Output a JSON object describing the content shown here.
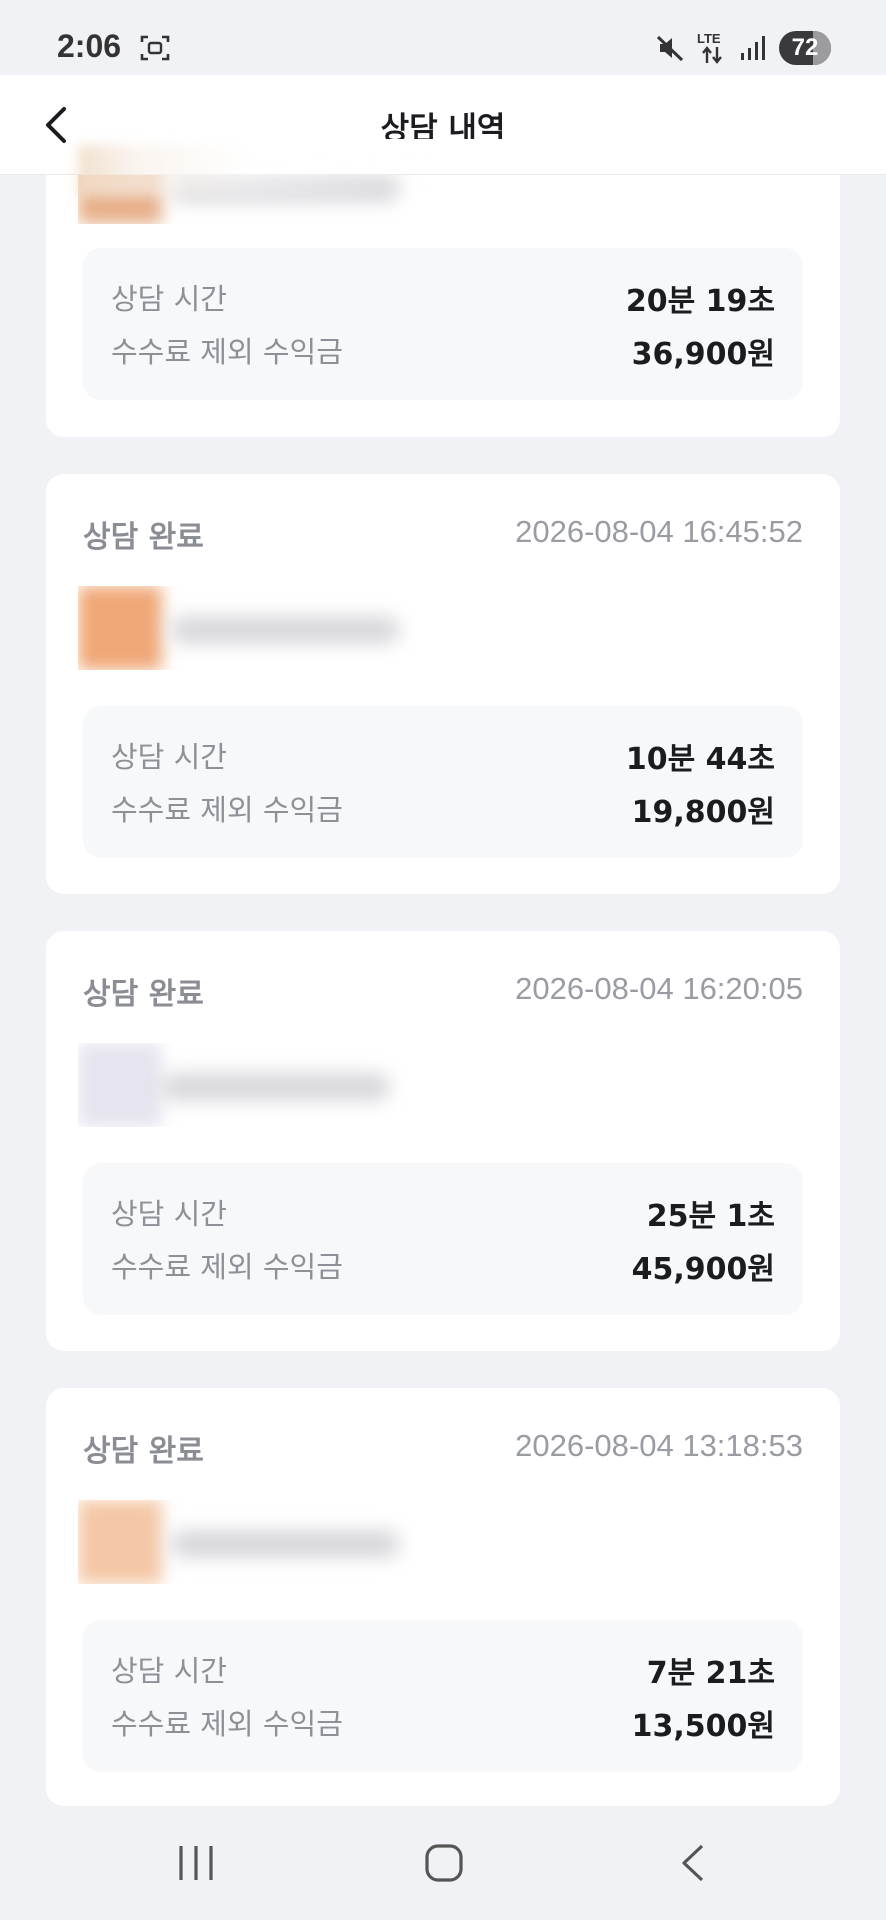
{
  "status_bar": {
    "time": "2:06",
    "network": "LTE",
    "battery": "72"
  },
  "header": {
    "title": "상담 내역"
  },
  "top_card": {
    "duration_label": "상담 시간",
    "duration_value": "20분 19초",
    "earnings_label": "수수료 제외 수익금",
    "earnings_value": "36,900원"
  },
  "records": [
    {
      "status": "상담 완료",
      "datetime": "2026-08-04 16:45:52",
      "duration_label": "상담 시간",
      "duration_value": "10분 44초",
      "earnings_label": "수수료 제외 수익금",
      "earnings_value": "19,800원",
      "avatar_color": "#f0a878"
    },
    {
      "status": "상담 완료",
      "datetime": "2026-08-04 16:20:05",
      "duration_label": "상담 시간",
      "duration_value": "25분 1초",
      "earnings_label": "수수료 제외 수익금",
      "earnings_value": "45,900원",
      "avatar_color": "#e6e4ee"
    },
    {
      "status": "상담 완료",
      "datetime": "2026-08-04 13:18:53",
      "duration_label": "상담 시간",
      "duration_value": "7분 21초",
      "earnings_label": "수수료 제외 수익금",
      "earnings_value": "13,500원",
      "avatar_color": "#f4c8a6"
    }
  ],
  "colors": {
    "background": "#f1f2f6",
    "card": "#ffffff",
    "info_box": "#f7f8fa",
    "muted_text": "#8e9097",
    "strong_text": "#1b1c1f"
  }
}
